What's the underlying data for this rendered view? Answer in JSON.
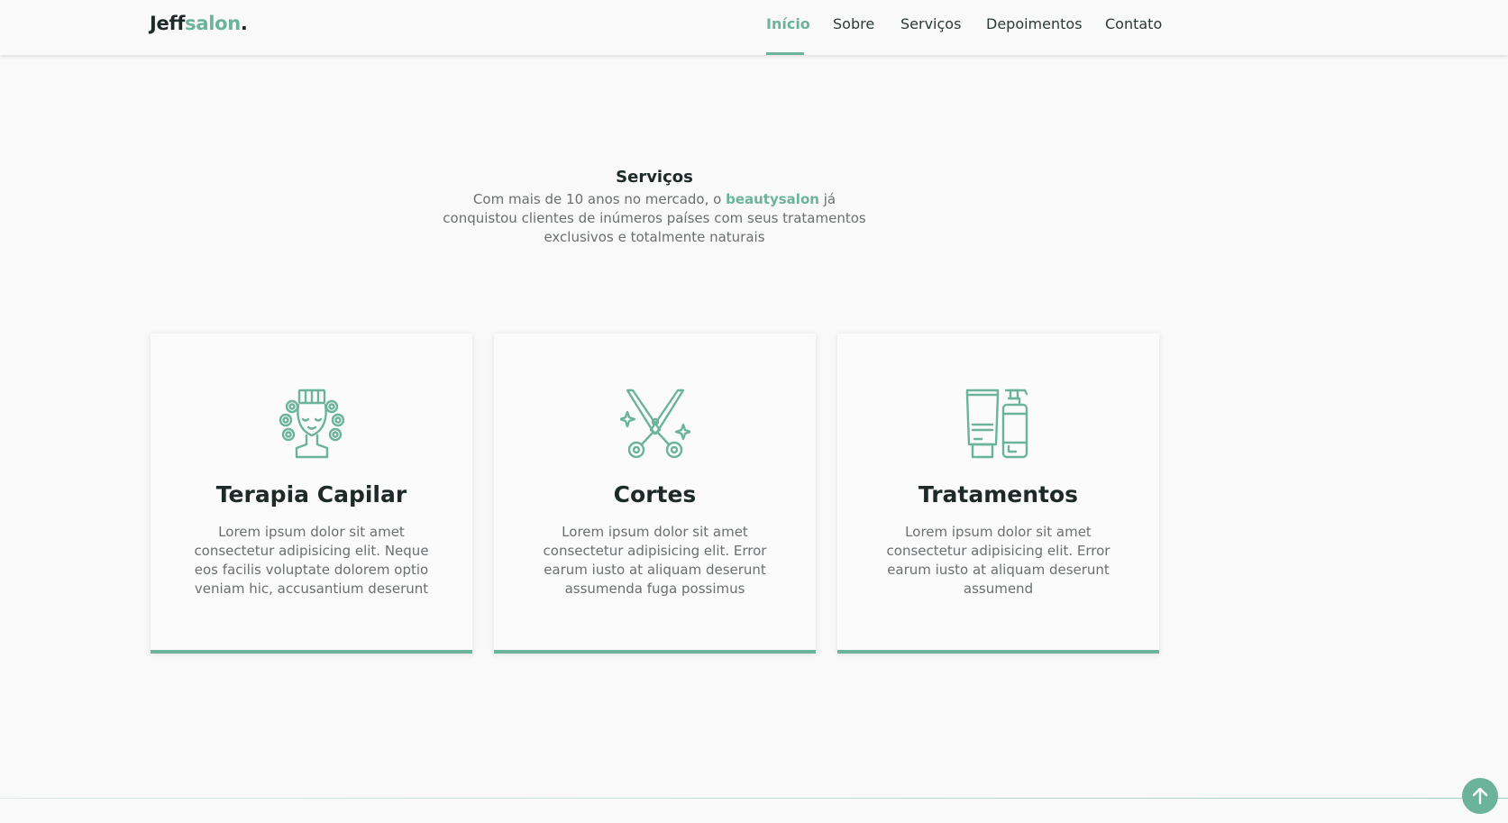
{
  "header": {
    "logo_primary": "Jeff",
    "logo_accent": "salon",
    "logo_dot": ".",
    "nav": [
      {
        "label": "Início",
        "active": true
      },
      {
        "label": "Sobre",
        "active": false
      },
      {
        "label": "Serviços",
        "active": false
      },
      {
        "label": "Depoimentos",
        "active": false
      },
      {
        "label": "Contato",
        "active": false
      }
    ]
  },
  "services": {
    "title": "Serviços",
    "desc_before": "Com mais de 10 anos no mercado, o ",
    "desc_highlight": "beautysalon",
    "desc_after": " já conquistou clientes de inúmeros países com seus tratamentos exclusivos e totalmente naturais",
    "cards": [
      {
        "icon": "hair-curlers-icon",
        "title": "Terapia Capilar",
        "text": "Lorem ipsum dolor sit amet consectetur adipisicing elit. Neque eos facilis voluptate dolorem optio veniam hic, accusantium deserunt"
      },
      {
        "icon": "scissors-icon",
        "title": "Cortes",
        "text": "Lorem ipsum dolor sit amet consectetur adipisicing elit. Error earum iusto at aliquam deserunt assumenda fuga possimus"
      },
      {
        "icon": "cosmetics-bottles-icon",
        "title": "Tratamentos",
        "text": "Lorem ipsum dolor sit amet consectetur adipisicing elit. Error earum iusto at aliquam deserunt assumend"
      }
    ]
  },
  "back_to_top": {
    "icon": "arrow-up-icon"
  },
  "colors": {
    "accent": "#6bb39a",
    "text_dark": "#1d2a27",
    "text_muted": "#6b6f70",
    "background": "#f9f9f9"
  }
}
